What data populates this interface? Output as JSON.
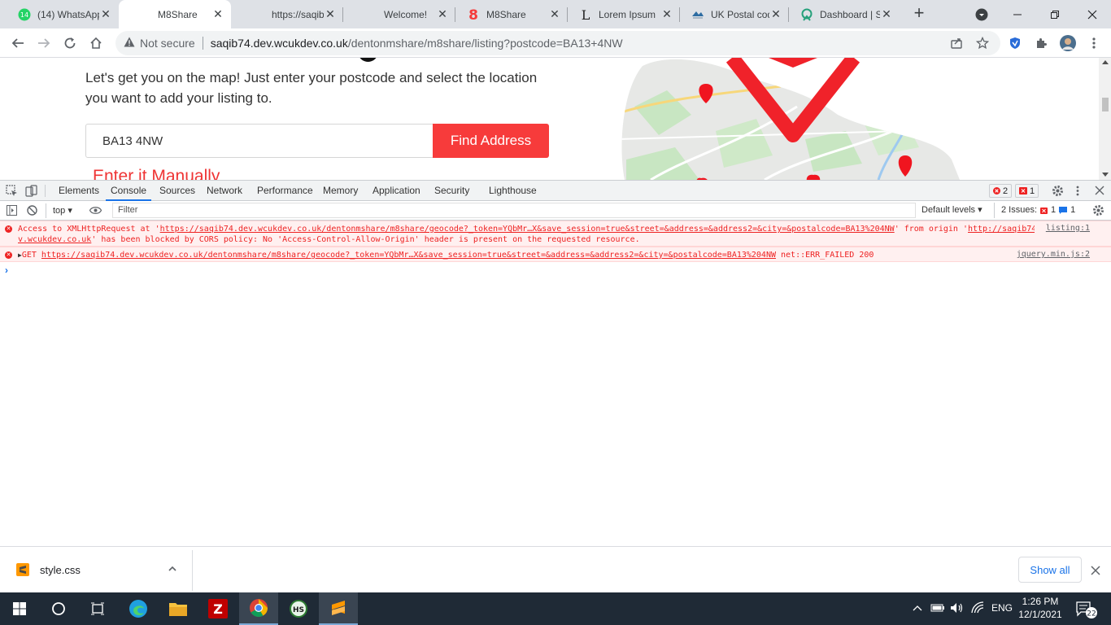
{
  "browser": {
    "tabs": [
      {
        "title": "(14) WhatsApp",
        "badge": "14",
        "icon": "whatsapp-icon"
      },
      {
        "title": "M8Share",
        "icon": "none",
        "active": true
      },
      {
        "title": "https://saqib74",
        "icon": "none"
      },
      {
        "title": "Welcome!",
        "icon": "none"
      },
      {
        "title": "M8Share",
        "icon": "m8share-logo-icon"
      },
      {
        "title": "Lorem Ipsum",
        "icon": "lorem-ipsum-icon"
      },
      {
        "title": "UK Postal code",
        "icon": "postal-icon"
      },
      {
        "title": "Dashboard | S",
        "icon": "dashboard-icon"
      }
    ],
    "address": {
      "security": "Not secure",
      "url_host": "saqib74.dev.wcukdev.co.uk",
      "url_path": "/dentonmshare/m8share/listing?postcode=BA13+4NW"
    }
  },
  "page": {
    "intro": "Let's get you on the map! Just enter your postcode and select the location you want to add your listing to.",
    "postcode_value": "BA13 4NW",
    "find_button": "Find Address",
    "manual_link": "Enter it Manually"
  },
  "devtools": {
    "tabs": [
      "Elements",
      "Console",
      "Sources",
      "Network",
      "Performance",
      "Memory",
      "Application",
      "Security",
      "Lighthouse"
    ],
    "active_tab": "Console",
    "error_count": "2",
    "issue_count": "1",
    "context": "top",
    "filter_placeholder": "Filter",
    "levels": "Default levels",
    "issues_label": "2 Issues:",
    "issues_err": "1",
    "issues_info": "1",
    "messages": [
      {
        "pre": "Access to XMLHttpRequest at '",
        "link": "https://saqib74.dev.wcukdev.co.uk/dentonmshare/m8share/geocode?_token=YQbMr…X&save_session=true&street=&address=&address2=&city=&postalcode=BA13%204NW",
        "mid": "' from origin '",
        "origin1": "http://saqib74.de",
        "origin2": "v.wcukdev.co.uk",
        "post": "' has been blocked by CORS policy: No 'Access-Control-Allow-Origin' header is present on the requested resource.",
        "source": "listing:1"
      },
      {
        "pre": "GET ",
        "link": "https://saqib74.dev.wcukdev.co.uk/dentonmshare/m8share/geocode?_token=YQbMr…X&save_session=true&street=&address=&address2=&city=&postalcode=BA13%204NW",
        "post": " net::ERR_FAILED 200",
        "source": "jquery.min.js:2"
      }
    ]
  },
  "downloads": {
    "file": "style.css",
    "show_all": "Show all"
  },
  "taskbar": {
    "lang": "ENG",
    "time": "1:26 PM",
    "date": "12/1/2021",
    "notifications": "22"
  }
}
